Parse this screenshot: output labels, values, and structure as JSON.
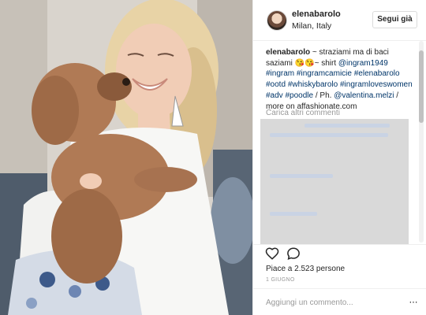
{
  "post": {
    "username": "elenabarolo",
    "location": "Milan, Italy",
    "follow_label": "Segui già",
    "caption_user": "elenabarolo",
    "caption_text_1": " ~ straziami ma di baci saziami ",
    "caption_emoji": "😘😘",
    "caption_text_2": "~ shirt ",
    "links": [
      "@ingram1949",
      "#ingram",
      "#ingramcamicie",
      "#elenabarolo",
      "#ootd",
      "#whiskybarolo",
      "#ingramloveswomen",
      "#adv",
      "#poodle",
      "@valentina.melzi"
    ],
    "caption_ph": " / Ph. ",
    "caption_more": " / more on affashionate.com",
    "load_more": "Carica altri commenti",
    "likes": "Piace a 2.523 persone",
    "date": "1 GIUGNO",
    "comment_placeholder": "Aggiungi un commento...",
    "more_icon": "⋯"
  },
  "icons": {
    "like": "heart-icon",
    "comment": "comment-bubble-icon",
    "options": "more-options-icon"
  },
  "colors": {
    "link": "#003569",
    "muted": "#999999",
    "border": "#efefef",
    "placeholder_block": "#d9d9d9"
  }
}
